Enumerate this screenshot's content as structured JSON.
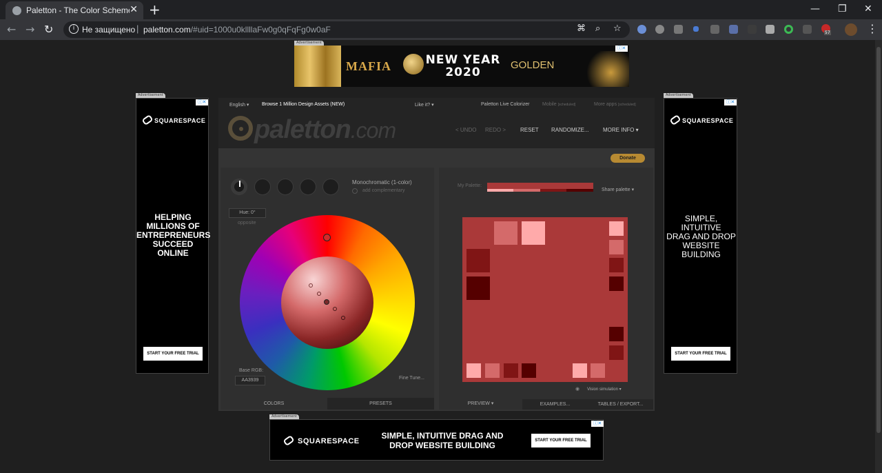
{
  "browser": {
    "tab_title": "Paletton - The Color Scheme Designer",
    "new_tab": "+",
    "security_label": "Не защищено",
    "separator": "|",
    "url_host": "paletton.com",
    "url_rest": "/#uid=1000u0kllllaFw0g0qFqFg0w0aF",
    "ext_badge": "57"
  },
  "ads": {
    "label": "Advertisement",
    "top_banner": {
      "word1": "MAFIA",
      "word2": "NEW YEAR\n2020",
      "word3": "GOLDEN"
    },
    "brand": "SQUARESPACE",
    "left_text": "HELPING\nMILLIONS OF\nENTREPRENEURS\nSUCCEED\nONLINE",
    "right_text": "SIMPLE,\nINTUITIVE\nDRAG AND DROP\nWEBSITE\nBUILDING",
    "bottom_text": "SIMPLE, INTUITIVE DRAG AND\nDROP WEBSITE BUILDING",
    "cta": "START YOUR FREE TRIAL",
    "close_glyph": "ⓘ✕"
  },
  "paletton": {
    "top_nav": {
      "language": "English",
      "browse": "Browse 1 Million Design Assets (NEW)",
      "like": "Like it?",
      "live": "Paletton Live Colorizer",
      "mobile": "Mobile",
      "mobile_tag": "[scheduled]",
      "more_apps": "More apps",
      "more_apps_tag": "[scheduled]"
    },
    "logo": {
      "name": "paletton",
      "tld": ".com"
    },
    "main_nav": {
      "undo": "< UNDO",
      "redo": "REDO >",
      "reset": "RESET",
      "randomize": "RANDOMIZE...",
      "more_info": "MORE INFO"
    },
    "donate": "Donate",
    "scheme_name": "Monochromatic (1-color)",
    "add_complementary": "add complementary",
    "hue": "Hue: 0°",
    "opposite": "opposite",
    "base_rgb_label": "Base RGB:",
    "base_rgb": "AA3939",
    "fine_tune": "Fine Tune...",
    "my_palette": "My Palette:",
    "share_palette": "Share palette",
    "vision_simulation": "Vision simulation",
    "tabs": {
      "colors": "COLORS",
      "presets": "PRESETS",
      "preview": "PREVIEW",
      "examples": "EXAMPLES...",
      "tables": "TABLES / EXPORT..."
    },
    "colors": {
      "base": "#aa3939",
      "light1": "#d46a6a",
      "light2": "#ffaaaa",
      "dark1": "#801515",
      "dark2": "#550000"
    }
  }
}
